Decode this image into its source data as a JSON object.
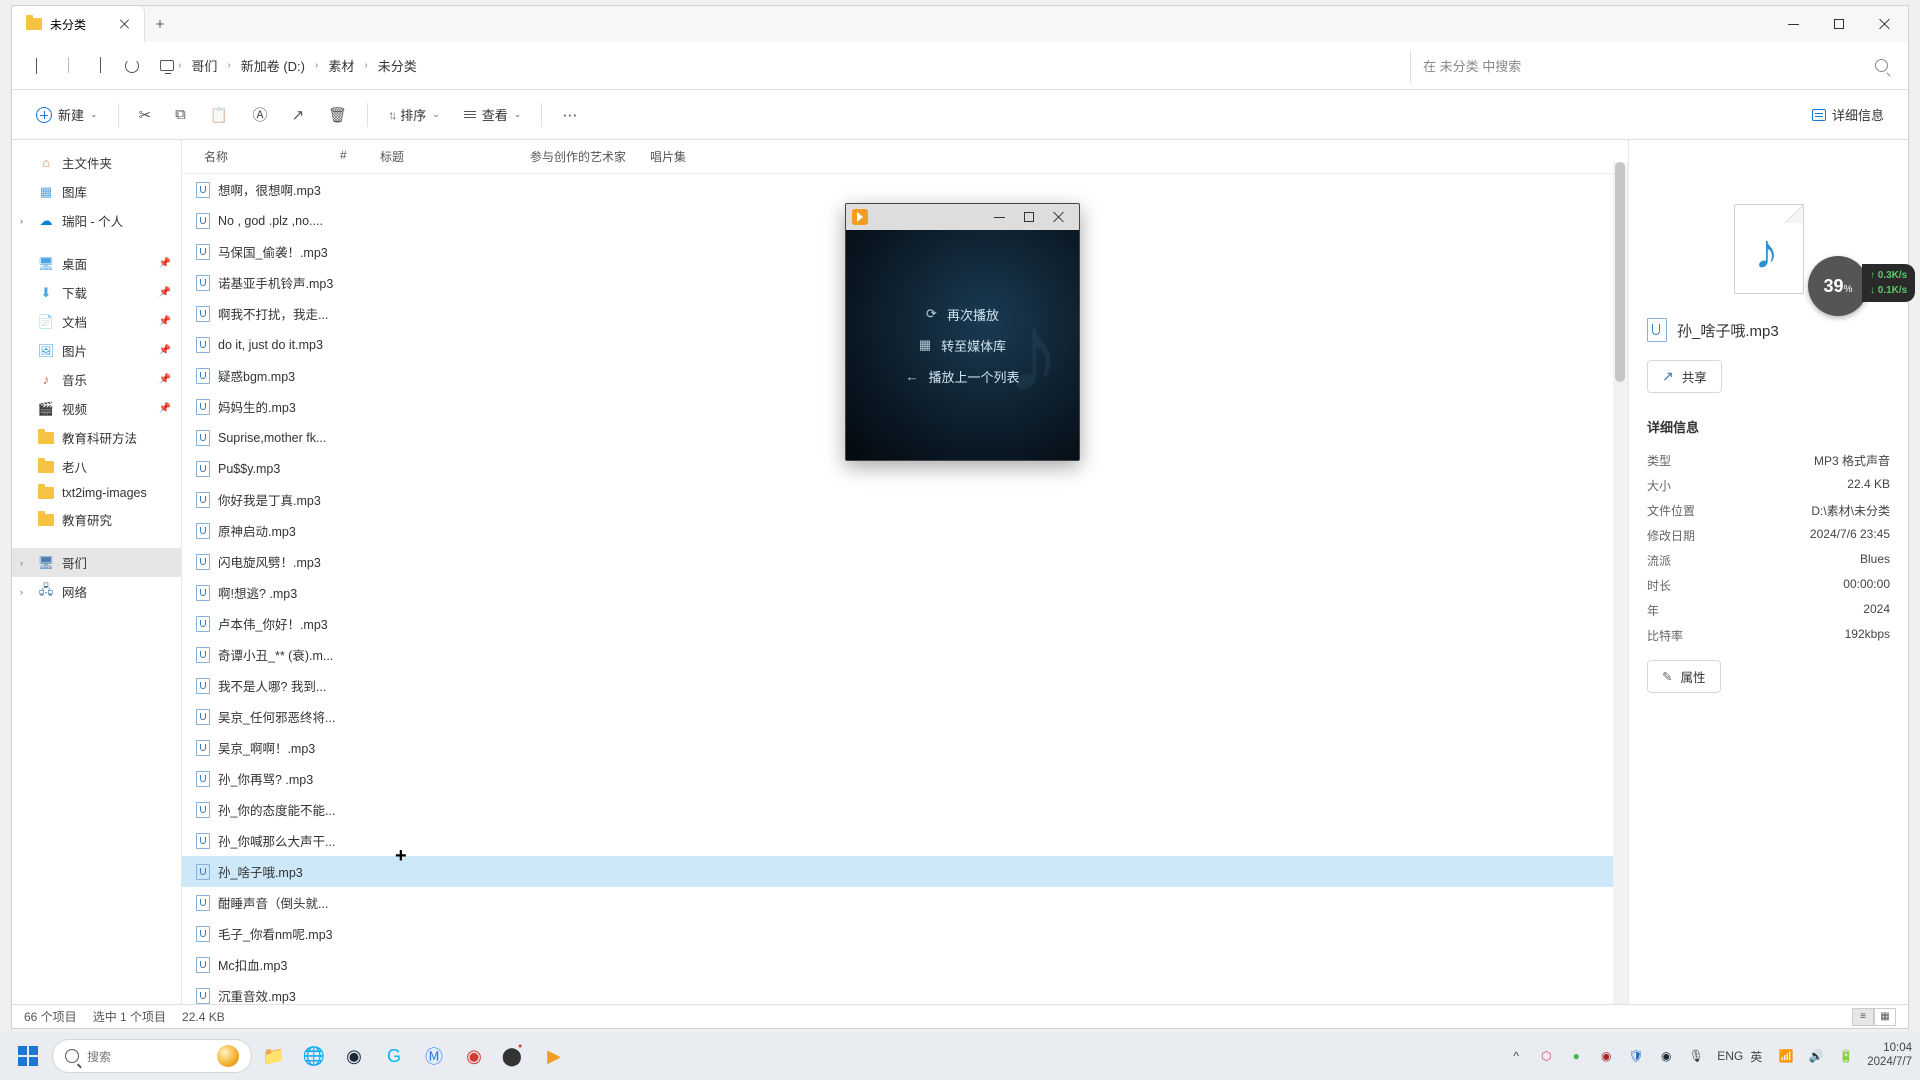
{
  "window": {
    "tab_title": "未分类",
    "controls": {
      "min": "minimize",
      "max": "maximize",
      "close": "close"
    }
  },
  "nav": {
    "breadcrumb": [
      "哥们",
      "新加卷 (D:)",
      "素材",
      "未分类"
    ],
    "search_placeholder": "在 未分类 中搜索"
  },
  "toolbar": {
    "new": "新建",
    "sort": "排序",
    "view": "查看",
    "details": "详细信息"
  },
  "columns": {
    "name": "名称",
    "hash": "#",
    "title": "标题",
    "artist": "参与创作的艺术家",
    "album": "唱片集"
  },
  "sidebar": {
    "home": "主文件夹",
    "gallery": "图库",
    "onedrive": "瑞阳 - 个人",
    "desktop": "桌面",
    "downloads": "下载",
    "documents": "文档",
    "pictures": "图片",
    "music": "音乐",
    "videos": "视频",
    "custom1": "教育科研方法",
    "custom2": "老八",
    "custom3": "txt2img-images",
    "custom4": "教育研究",
    "thispc": "哥们",
    "network": "网络"
  },
  "files": [
    "想啊，很想啊.mp3",
    "No , god .plz ,no....",
    "马保国_偷袭！.mp3",
    "诺基亚手机铃声.mp3",
    "啊我不打扰，我走...",
    "do it, just do it.mp3",
    "疑惑bgm.mp3",
    "妈妈生的.mp3",
    "Suprise,mother fk...",
    "Pu$$y.mp3",
    "你好我是丁真.mp3",
    "原神启动.mp3",
    "闪电旋风劈！.mp3",
    "啊!想逃? .mp3",
    "卢本伟_你好！.mp3",
    "奇谭小丑_** (衰).m...",
    "我不是人哪? 我到...",
    "吴京_任何邪恶终将...",
    "吴京_啊啊！.mp3",
    "孙_你再骂? .mp3",
    "孙_你的态度能不能...",
    "孙_你喊那么大声干...",
    "孙_啥子哦.mp3",
    "酣睡声音（倒头就...",
    "毛子_你看nm呢.mp3",
    "Mc扣血.mp3",
    "沉重音效.mp3"
  ],
  "selected_index": 22,
  "details": {
    "filename": "孙_啥子哦.mp3",
    "share": "共享",
    "header": "详细信息",
    "rows": {
      "type_k": "类型",
      "type_v": "MP3 格式声音",
      "size_k": "大小",
      "size_v": "22.4 KB",
      "loc_k": "文件位置",
      "loc_v": "D:\\素材\\未分类",
      "mod_k": "修改日期",
      "mod_v": "2024/7/6 23:45",
      "genre_k": "流派",
      "genre_v": "Blues",
      "dur_k": "时长",
      "dur_v": "00:00:00",
      "year_k": "年",
      "year_v": "2024",
      "bitrate_k": "比特率",
      "bitrate_v": "192kbps"
    },
    "props": "属性"
  },
  "net_widget": {
    "percent": "39",
    "up": "0.3K/s",
    "down": "0.1K/s"
  },
  "player": {
    "replay": "再次播放",
    "library": "转至媒体库",
    "prev_list": "播放上一个列表"
  },
  "statusbar": {
    "count": "66 个项目",
    "selected": "选中 1 个项目",
    "size": "22.4 KB"
  },
  "taskbar": {
    "search": "搜索",
    "lang": "ENG",
    "ime": "英",
    "time": "10:04",
    "date": "2024/7/7"
  }
}
